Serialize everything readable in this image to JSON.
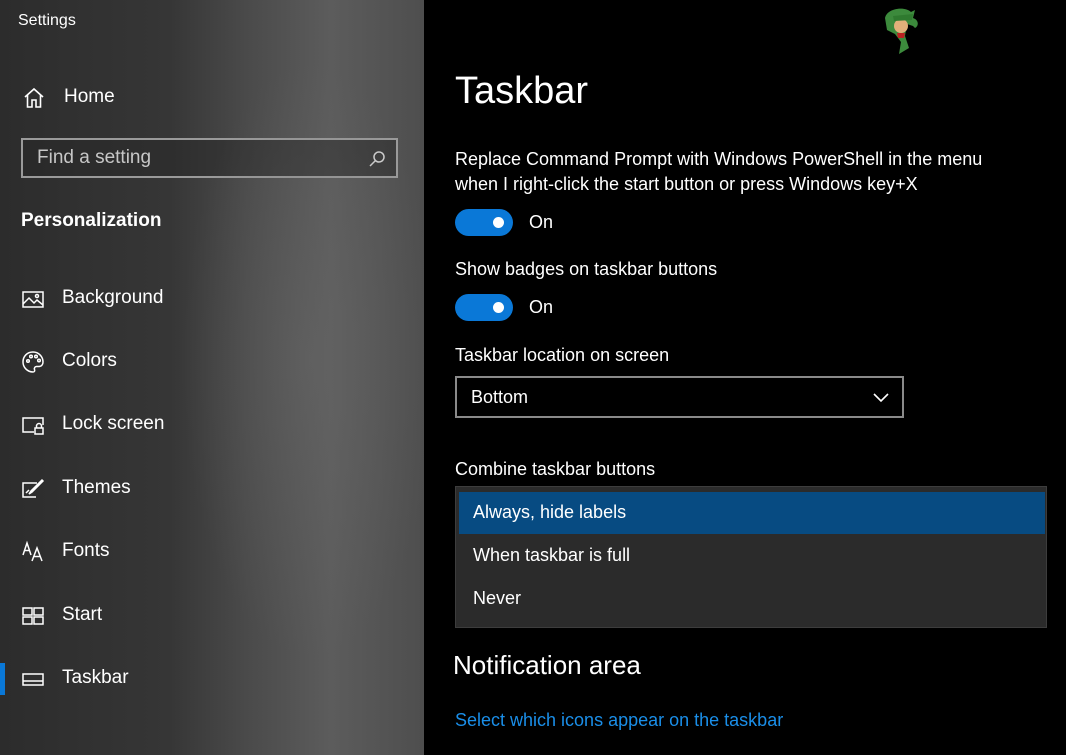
{
  "window": {
    "title": "Settings"
  },
  "sidebar": {
    "home_label": "Home",
    "search": {
      "placeholder": "Find a setting"
    },
    "section_title": "Personalization",
    "items": [
      {
        "label": "Background",
        "icon": "picture-icon"
      },
      {
        "label": "Colors",
        "icon": "palette-icon"
      },
      {
        "label": "Lock screen",
        "icon": "lock-screen-icon"
      },
      {
        "label": "Themes",
        "icon": "themes-icon"
      },
      {
        "label": "Fonts",
        "icon": "fonts-icon"
      },
      {
        "label": "Start",
        "icon": "start-icon"
      },
      {
        "label": "Taskbar",
        "icon": "taskbar-icon",
        "active": true
      }
    ]
  },
  "main": {
    "title": "Taskbar",
    "settings": {
      "powershell": {
        "label_line1": "Replace Command Prompt with Windows PowerShell in the menu",
        "label_line2": "when I right-click the start button or press Windows key+X",
        "state": "On"
      },
      "badges": {
        "label": "Show badges on taskbar buttons",
        "state": "On"
      },
      "location": {
        "label": "Taskbar location on screen",
        "value": "Bottom"
      },
      "combine": {
        "label": "Combine taskbar buttons",
        "options": [
          "Always, hide labels",
          "When taskbar is full",
          "Never"
        ],
        "selected": "Always, hide labels"
      }
    },
    "notification_area": {
      "heading": "Notification area",
      "link": "Select which icons appear on the taskbar"
    }
  },
  "colors": {
    "accent": "#0a78d7",
    "link": "#1a8ee8",
    "dropdown_selected": "#074b82"
  }
}
